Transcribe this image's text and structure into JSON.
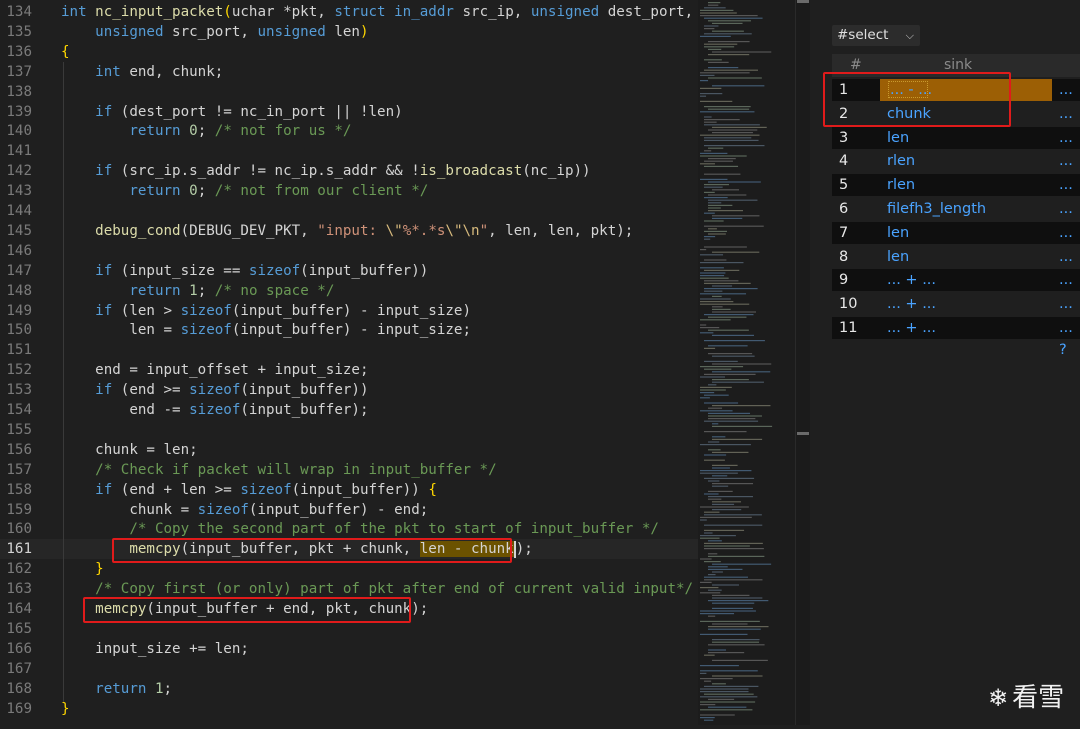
{
  "editor": {
    "lines": [
      {
        "num": "134",
        "segments": [
          [
            "k",
            "int "
          ],
          [
            "f",
            "nc_input_packet"
          ],
          [
            "p",
            "("
          ],
          [
            "",
            "uchar *pkt, "
          ],
          [
            "k",
            "struct "
          ],
          [
            "k",
            "in_addr "
          ],
          [
            "",
            "src_ip, "
          ],
          [
            "k",
            "unsigned "
          ],
          [
            "",
            "dest_port,"
          ]
        ]
      },
      {
        "num": "135",
        "segments": [
          [
            "",
            "    "
          ],
          [
            "k",
            "unsigned "
          ],
          [
            "",
            "src_port, "
          ],
          [
            "k",
            "unsigned "
          ],
          [
            "",
            "len"
          ],
          [
            "p",
            ")"
          ]
        ]
      },
      {
        "num": "136",
        "segments": [
          [
            "p",
            "{"
          ]
        ]
      },
      {
        "num": "137",
        "segments": [
          [
            "",
            "    "
          ],
          [
            "k",
            "int "
          ],
          [
            "",
            "end, chunk;"
          ]
        ]
      },
      {
        "num": "138",
        "segments": []
      },
      {
        "num": "139",
        "segments": [
          [
            "",
            "    "
          ],
          [
            "k",
            "if "
          ],
          [
            "",
            "(dest_port != nc_in_port || !len)"
          ]
        ]
      },
      {
        "num": "140",
        "segments": [
          [
            "",
            "        "
          ],
          [
            "k",
            "return "
          ],
          [
            "n",
            "0"
          ],
          [
            "",
            "; "
          ],
          [
            "c",
            "/* not for us */"
          ]
        ]
      },
      {
        "num": "141",
        "segments": []
      },
      {
        "num": "142",
        "segments": [
          [
            "",
            "    "
          ],
          [
            "k",
            "if "
          ],
          [
            "",
            "(src_ip.s_addr != nc_ip.s_addr && !"
          ],
          [
            "f",
            "is_broadcast"
          ],
          [
            "",
            "(nc_ip))"
          ]
        ]
      },
      {
        "num": "143",
        "segments": [
          [
            "",
            "        "
          ],
          [
            "k",
            "return "
          ],
          [
            "n",
            "0"
          ],
          [
            "",
            "; "
          ],
          [
            "c",
            "/* not from our client */"
          ]
        ]
      },
      {
        "num": "144",
        "segments": []
      },
      {
        "num": "145",
        "segments": [
          [
            "",
            "    "
          ],
          [
            "f",
            "debug_cond"
          ],
          [
            "",
            "(DEBUG_DEV_PKT, "
          ],
          [
            "s",
            "\"input: "
          ],
          [
            "e",
            "\\\""
          ],
          [
            "s",
            "%*.*s"
          ],
          [
            "e",
            "\\\"\\n"
          ],
          [
            "s",
            "\""
          ],
          [
            "",
            ", len, len, pkt);"
          ]
        ]
      },
      {
        "num": "146",
        "segments": []
      },
      {
        "num": "147",
        "segments": [
          [
            "",
            "    "
          ],
          [
            "k",
            "if "
          ],
          [
            "",
            "(input_size == "
          ],
          [
            "k",
            "sizeof"
          ],
          [
            "",
            "(input_buffer))"
          ]
        ]
      },
      {
        "num": "148",
        "segments": [
          [
            "",
            "        "
          ],
          [
            "k",
            "return "
          ],
          [
            "n",
            "1"
          ],
          [
            "",
            "; "
          ],
          [
            "c",
            "/* no space */"
          ]
        ]
      },
      {
        "num": "149",
        "segments": [
          [
            "",
            "    "
          ],
          [
            "k",
            "if "
          ],
          [
            "",
            "(len > "
          ],
          [
            "k",
            "sizeof"
          ],
          [
            "",
            "(input_buffer) - input_size)"
          ]
        ]
      },
      {
        "num": "150",
        "segments": [
          [
            "",
            "        len = "
          ],
          [
            "k",
            "sizeof"
          ],
          [
            "",
            "(input_buffer) - input_size;"
          ]
        ]
      },
      {
        "num": "151",
        "segments": []
      },
      {
        "num": "152",
        "segments": [
          [
            "",
            "    end = input_offset + input_size;"
          ]
        ]
      },
      {
        "num": "153",
        "segments": [
          [
            "",
            "    "
          ],
          [
            "k",
            "if "
          ],
          [
            "",
            "(end >= "
          ],
          [
            "k",
            "sizeof"
          ],
          [
            "",
            "(input_buffer))"
          ]
        ]
      },
      {
        "num": "154",
        "segments": [
          [
            "",
            "        end -= "
          ],
          [
            "k",
            "sizeof"
          ],
          [
            "",
            "(input_buffer);"
          ]
        ]
      },
      {
        "num": "155",
        "segments": []
      },
      {
        "num": "156",
        "segments": [
          [
            "",
            "    chunk = len;"
          ]
        ]
      },
      {
        "num": "157",
        "segments": [
          [
            "",
            "    "
          ],
          [
            "c",
            "/* Check if packet will wrap in input_buffer */"
          ]
        ]
      },
      {
        "num": "158",
        "segments": [
          [
            "",
            "    "
          ],
          [
            "k",
            "if "
          ],
          [
            "",
            "(end + len >= "
          ],
          [
            "k",
            "sizeof"
          ],
          [
            "",
            "(input_buffer)) "
          ],
          [
            "p",
            "{"
          ]
        ]
      },
      {
        "num": "159",
        "segments": [
          [
            "",
            "        chunk = "
          ],
          [
            "k",
            "sizeof"
          ],
          [
            "",
            "(input_buffer) - end;"
          ]
        ]
      },
      {
        "num": "160",
        "segments": [
          [
            "",
            "        "
          ],
          [
            "c",
            "/* Copy the second part of the pkt to start of input_buffer */"
          ]
        ]
      },
      {
        "num": "161",
        "segments": [
          [
            "",
            "        "
          ],
          [
            "f",
            "memcpy"
          ],
          [
            "",
            "(input_buffer, pkt + chunk, "
          ],
          [
            "hl",
            "len - chunk"
          ],
          [
            "cur",
            ""
          ],
          [
            "",
            ");"
          ]
        ],
        "active": true
      },
      {
        "num": "162",
        "segments": [
          [
            "",
            "    "
          ],
          [
            "p",
            "}"
          ]
        ]
      },
      {
        "num": "163",
        "segments": [
          [
            "",
            "    "
          ],
          [
            "c",
            "/* Copy first (or only) part of pkt after end of current valid input*/"
          ]
        ]
      },
      {
        "num": "164",
        "segments": [
          [
            "",
            "    "
          ],
          [
            "f",
            "memcpy"
          ],
          [
            "",
            "(input_buffer + end, pkt, chunk);"
          ]
        ]
      },
      {
        "num": "165",
        "segments": []
      },
      {
        "num": "166",
        "segments": [
          [
            "",
            "    input_size += len;"
          ]
        ]
      },
      {
        "num": "167",
        "segments": []
      },
      {
        "num": "168",
        "segments": [
          [
            "",
            "    "
          ],
          [
            "k",
            "return "
          ],
          [
            "n",
            "1"
          ],
          [
            "",
            ";"
          ]
        ]
      },
      {
        "num": "169",
        "segments": [
          [
            "p",
            "}"
          ]
        ]
      }
    ]
  },
  "panel": {
    "select_label": "#select",
    "columns": [
      "#",
      "sink"
    ],
    "rows": [
      {
        "idx": "1",
        "sink": "... - ...",
        "more": "... ?"
      },
      {
        "idx": "2",
        "sink": "chunk",
        "more": "... ?"
      },
      {
        "idx": "3",
        "sink": "len",
        "more": "... ?"
      },
      {
        "idx": "4",
        "sink": "rlen",
        "more": "... ?"
      },
      {
        "idx": "5",
        "sink": "rlen",
        "more": "... ?"
      },
      {
        "idx": "6",
        "sink": "filefh3_length",
        "more": "... ?"
      },
      {
        "idx": "7",
        "sink": "len",
        "more": "... ?"
      },
      {
        "idx": "8",
        "sink": "len",
        "more": "... ?"
      },
      {
        "idx": "9",
        "sink": "... + ...",
        "more": "... ?"
      },
      {
        "idx": "10",
        "sink": "... + ...",
        "more": "... ?"
      },
      {
        "idx": "11",
        "sink": "... + ...",
        "more": "... ?"
      }
    ]
  },
  "watermark": {
    "text": "看雪"
  }
}
